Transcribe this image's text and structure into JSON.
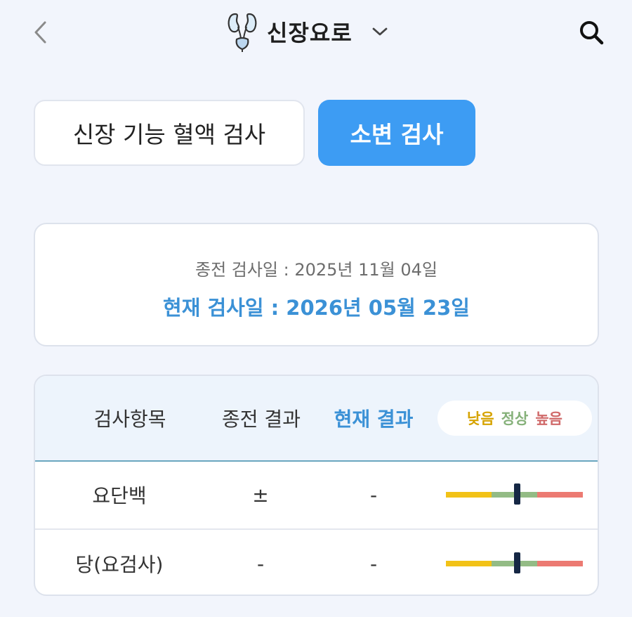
{
  "header": {
    "title": "신장요로",
    "icons": {
      "back": "chevron-left-icon",
      "kidney": "kidney-icon",
      "dropdown": "chevron-down-icon",
      "search": "search-icon"
    }
  },
  "tabs": [
    {
      "label": "신장 기능 혈액 검사",
      "active": false
    },
    {
      "label": "소변 검사",
      "active": true
    }
  ],
  "dates": {
    "previous": "종전 검사일 : 2025년 11월 04일",
    "current": "현재 검사일 : 2026년 05월 23일"
  },
  "results": {
    "columns": {
      "item": "검사항목",
      "previous": "종전 결과",
      "current": "현재 결과"
    },
    "legend": {
      "low": "낮음",
      "normal": "정상",
      "high": "높음"
    },
    "rows": [
      {
        "item": "요단백",
        "previous": "±",
        "current": "-",
        "level": 0.52
      },
      {
        "item": "당(요검사)",
        "previous": "-",
        "current": "-",
        "level": 0.52
      }
    ]
  },
  "colors": {
    "accent": "#3d9cf3",
    "current_text": "#3b91d6",
    "gauge_low": "#f2c217",
    "gauge_normal": "#93bb85",
    "gauge_high": "#ec7a72",
    "marker": "#152744"
  }
}
